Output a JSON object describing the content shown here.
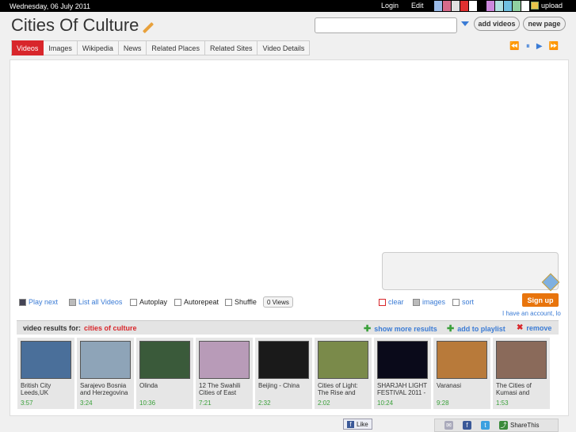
{
  "topbar": {
    "date": "Wednesday, 06 July 2011",
    "login": "Login",
    "edit": "Edit",
    "upload": "upload",
    "swatches": [
      "#9bbbe8",
      "#d66a8a",
      "#e0e0e0",
      "#e03030",
      "#ffffff",
      "#000000",
      "#cc88dd",
      "#b0e0e0",
      "#70c0e0",
      "#90d0a0",
      "#ffffff"
    ]
  },
  "header": {
    "title": "Cities Of Culture",
    "add_videos": "add videos",
    "new_page": "new page"
  },
  "tabs": [
    "Videos",
    "Images",
    "Wikipedia",
    "News",
    "Related Places",
    "Related Sites",
    "Video Details"
  ],
  "media": {
    "prev": "⏪",
    "pause": "⏸",
    "play": "▶",
    "next": "⏩"
  },
  "controls": {
    "play_next": "Play next",
    "list_all": "List all Videos",
    "autoplay": "Autoplay",
    "autorepeat": "Autorepeat",
    "shuffle": "Shuffle",
    "views": "0 Views",
    "clear": "clear",
    "images": "images",
    "sort": "sort",
    "signup": "Sign up",
    "account": "I have an account, lo"
  },
  "results": {
    "label": "video results for:",
    "query": "cities of culture",
    "show_more": "show more results",
    "add_playlist": "add to playlist",
    "remove": "remove"
  },
  "videos": [
    {
      "title": "British City Leeds,UK",
      "duration": "3:57",
      "color": "#4a6f9a"
    },
    {
      "title": "Sarajevo Bosnia and Herzegovina",
      "duration": "3:24",
      "color": "#8ea4b8"
    },
    {
      "title": "Olinda",
      "duration": "10:36",
      "color": "#3a5a3a"
    },
    {
      "title": "12 The Swahili Cities of East",
      "duration": "7:21",
      "color": "#b89bb8"
    },
    {
      "title": "Beijing - China",
      "duration": "2:32",
      "color": "#1a1a1a"
    },
    {
      "title": "Cities of Light: The Rise and",
      "duration": "2:02",
      "color": "#7a8a4a"
    },
    {
      "title": "SHARJAH LIGHT FESTIVAL 2011 -",
      "duration": "10:24",
      "color": "#0a0a1a"
    },
    {
      "title": "Varanasi",
      "duration": "9:28",
      "color": "#b87a3a"
    },
    {
      "title": "The Cities of Kumasi and",
      "duration": "1:53",
      "color": "#8a6a5a"
    }
  ],
  "footer": {
    "like": "Like",
    "sharethis": "ShareThis"
  }
}
